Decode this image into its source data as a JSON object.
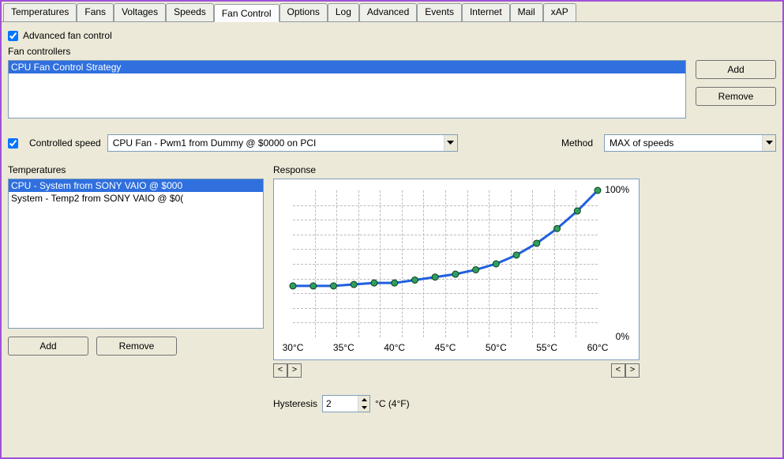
{
  "tabs": [
    {
      "label": "Temperatures"
    },
    {
      "label": "Fans"
    },
    {
      "label": "Voltages"
    },
    {
      "label": "Speeds"
    },
    {
      "label": "Fan Control"
    },
    {
      "label": "Options"
    },
    {
      "label": "Log"
    },
    {
      "label": "Advanced"
    },
    {
      "label": "Events"
    },
    {
      "label": "Internet"
    },
    {
      "label": "Mail"
    },
    {
      "label": "xAP"
    }
  ],
  "active_tab_index": 4,
  "advanced_fan_control": {
    "label": "Advanced fan control",
    "checked": true
  },
  "fan_controllers": {
    "label": "Fan controllers",
    "items": [
      "CPU Fan Control Strategy"
    ],
    "selected_index": 0,
    "add_label": "Add",
    "remove_label": "Remove"
  },
  "controlled_speed": {
    "checked": true,
    "label": "Controlled speed",
    "selected": "CPU Fan - Pwm1 from Dummy @ $0000 on PCI"
  },
  "method": {
    "label": "Method",
    "selected": "MAX of speeds"
  },
  "temperatures": {
    "label": "Temperatures",
    "items": [
      "CPU - System from SONY VAIO @ $000",
      "System - Temp2 from SONY VAIO @ $0(truncated)"
    ],
    "items_display": [
      "CPU - System from SONY VAIO @ $000",
      "System - Temp2 from SONY VAIO @ $0("
    ],
    "selected_index": 0,
    "add_label": "Add",
    "remove_label": "Remove"
  },
  "response": {
    "label": "Response"
  },
  "chart_data": {
    "type": "line",
    "x": [
      30,
      32,
      34,
      36,
      38,
      40,
      42,
      44,
      46,
      48,
      50,
      52,
      54,
      56,
      58,
      60
    ],
    "y": [
      35,
      35,
      35,
      36,
      37,
      37,
      39,
      41,
      43,
      46,
      50,
      56,
      64,
      74,
      86,
      100
    ],
    "xlim": [
      30,
      60
    ],
    "ylim": [
      0,
      100
    ],
    "xticks": [
      "30°C",
      "35°C",
      "40°C",
      "45°C",
      "50°C",
      "55°C",
      "60°C"
    ],
    "yticks_labels": [
      {
        "value": 100,
        "label": "100%"
      },
      {
        "value": 0,
        "label": "0%"
      }
    ],
    "hgrid_lines": 10,
    "vgrid_lines": 14,
    "line_color": "#205fde",
    "marker_fill": "#2f9f5f",
    "marker_stroke": "#0a3e1a"
  },
  "lower_nav": {
    "left_lt": "<",
    "left_gt": ">",
    "right_lt": "<",
    "right_gt": ">"
  },
  "hysteresis": {
    "label": "Hysteresis",
    "value": "2",
    "suffix": "°C (4°F)"
  }
}
